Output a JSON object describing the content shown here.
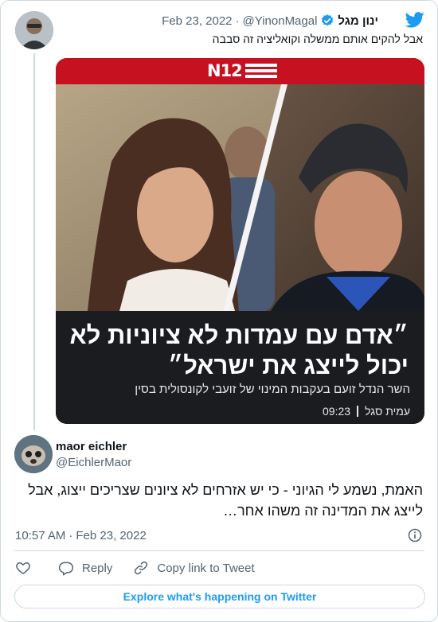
{
  "quoted_tweet": {
    "author_name": "ינון מגל",
    "handle": "@YinonMagal",
    "separator": "·",
    "date": "Feb 23, 2022",
    "text": "אבל להקים אותם ממשלה וקואליציה זה סבבה",
    "verified": true,
    "media": {
      "channel_logo": "N12",
      "headline": "״אדם עם עמדות לא ציוניות לא יכול לייצג את ישראל״",
      "subheadline": "השר הנדל זועם בעקבות המינוי של זועבי לקונסולית בסין",
      "reporter": "עמית סגל",
      "time": "09:23"
    }
  },
  "reply_tweet": {
    "author_name": "maor eichler",
    "handle": "@EichlerMaor",
    "text": "האמת, נשמע לי הגיוני - כי יש אזרחים לא ציונים שצריכים ייצוג, אבל לייצג את המדינה זה משהו אחר…",
    "time": "10:57 AM",
    "separator": "·",
    "date": "Feb 23, 2022"
  },
  "actions": {
    "like_icon": "heart-icon",
    "reply_label": "Reply",
    "copy_label": "Copy link to Tweet"
  },
  "explore_label": "Explore what's happening on Twitter",
  "colors": {
    "twitter_blue": "#1d9bf0",
    "n12_red": "#c61120",
    "text_primary": "#0f1419",
    "text_secondary": "#536471",
    "border": "#cfd9de"
  }
}
